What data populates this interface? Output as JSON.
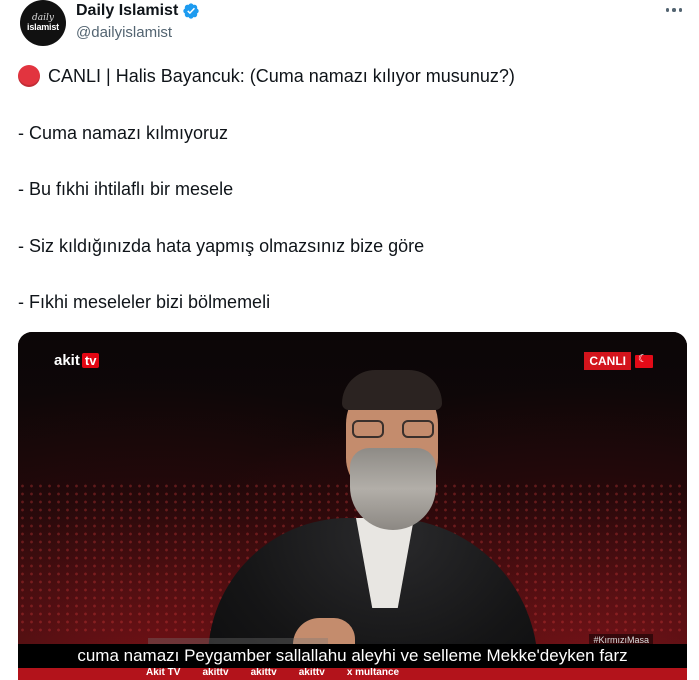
{
  "author": {
    "avatar_line1": "daily",
    "avatar_line2": "islamist",
    "display_name": "Daily Islamist",
    "handle": "@dailyislamist",
    "verified": true
  },
  "tweet": {
    "lines": [
      "CANLI | Halis Bayancuk: (Cuma namazı kılıyor musunuz?)",
      "- Cuma namazı kılmıyoruz",
      "- Bu fıkhi ihtilaflı bir mesele",
      "- Siz kıldığınızda hata yapmış olmazsınız bize göre",
      "- Fıkhi meseleler bizi bölmemeli"
    ],
    "live_dot_color": "#e2343f"
  },
  "video": {
    "channel_logo_text": "akit",
    "channel_logo_tv": "tv",
    "live_badge": "CANLI",
    "hashtag": "#KırmızıMasa",
    "subtitle": "cuma namazı Peygamber sallallahu aleyhi ve selleme Mekke'deyken farz",
    "social": [
      "Akit TV",
      "akittv",
      "akittv",
      "akittv",
      "x multance"
    ],
    "accent_color": "#d3141c"
  }
}
